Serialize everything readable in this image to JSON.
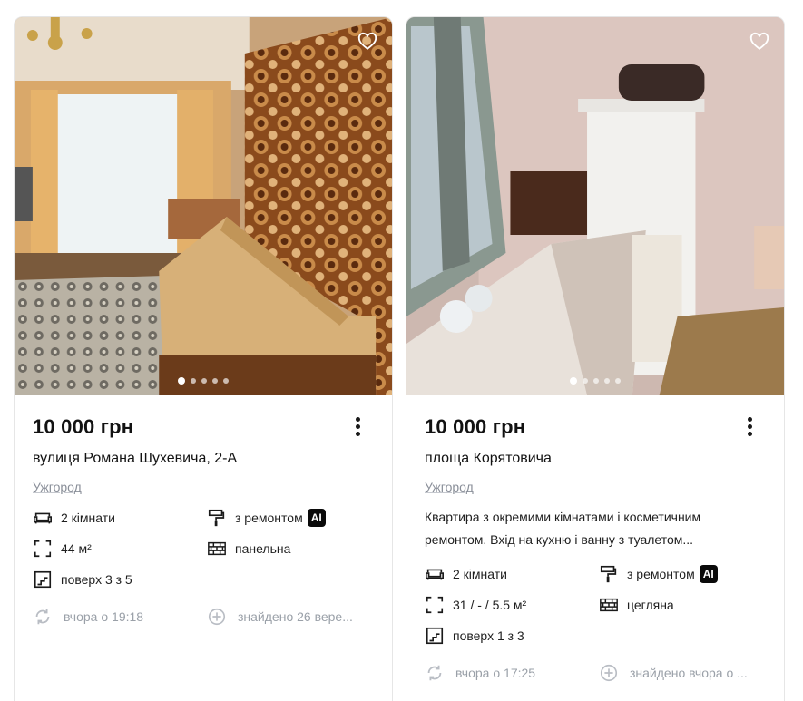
{
  "listings": [
    {
      "price": "10 000 грн",
      "address": "вулиця Романа Шухевича, 2-А",
      "city": "Ужгород",
      "description": "",
      "rooms": "2 кімнати",
      "renovation": "з ремонтом",
      "ai_badge": "AI",
      "area": "44 м²",
      "building": "панельна",
      "floor": "поверх 3 з 5",
      "updated": "вчора о 19:18",
      "found": "знайдено 26 вере...",
      "photo_index": 1,
      "photo_count": 5
    },
    {
      "price": "10 000 грн",
      "address": "площа Корятовича",
      "city": "Ужгород",
      "description": "Квартира з окремими кімнатами і косметичним ремонтом. Вхід на кухню і ванну з туалетом...",
      "rooms": "2 кімнати",
      "renovation": "з ремонтом",
      "ai_badge": "AI",
      "area": "31 / - / 5.5 м²",
      "building": "цегляна",
      "floor": "поверх 1 з 3",
      "updated": "вчора о 17:25",
      "found": "знайдено вчора о ...",
      "photo_index": 1,
      "photo_count": 5
    }
  ],
  "icons": {
    "favorite": "heart-icon",
    "more": "kebab-menu-icon",
    "rooms": "sofa-icon",
    "renovation": "paint-roller-icon",
    "area": "area-frame-icon",
    "building": "brick-wall-icon",
    "floor": "stairs-icon",
    "updated": "refresh-icon",
    "found": "plus-circle-icon"
  },
  "colors": {
    "price": "#121212",
    "muted": "#9aa0a8",
    "badge": "#0a0a0a"
  }
}
